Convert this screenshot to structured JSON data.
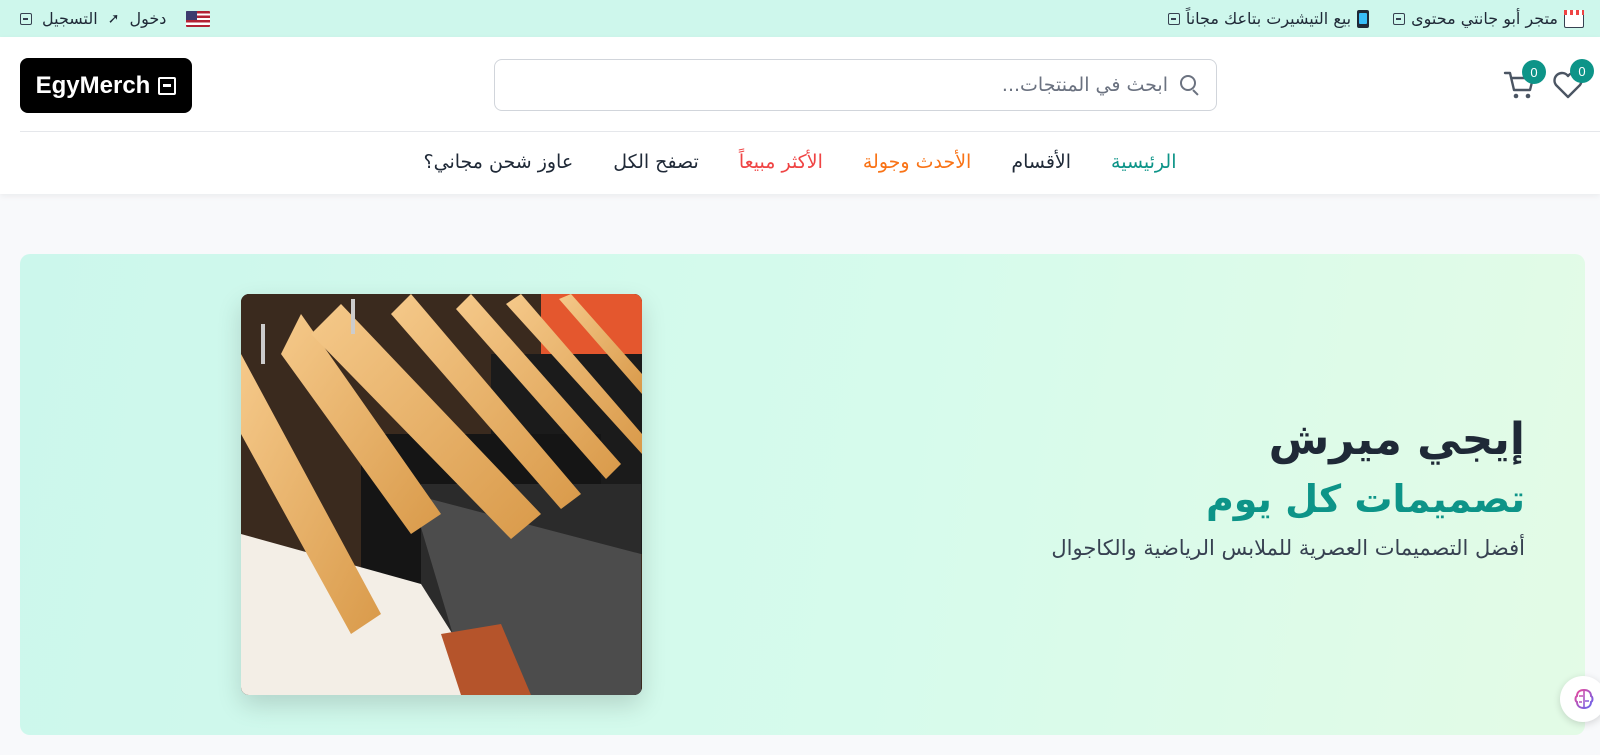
{
  "topbar": {
    "language_flag": "us-flag-icon",
    "login_label": "دخول",
    "register_label": "التسجيل",
    "promo_store": "متجر أبو جانتي محتوى",
    "promo_sell": "بيع التيشيرت بتاعك مجاناً"
  },
  "header": {
    "logo_text": "EgyMerch",
    "search_placeholder": "ابحث في المنتجات...",
    "cart_count": "0",
    "wishlist_count": "0"
  },
  "nav": {
    "items": [
      {
        "label": "الرئيسية"
      },
      {
        "label": "الأقسام"
      },
      {
        "label": "الأحدث وجولة"
      },
      {
        "label": "الأكثر مبيعاً"
      },
      {
        "label": "تصفح الكل"
      },
      {
        "label": "عاوز شحن مجاني؟"
      }
    ]
  },
  "hero": {
    "title": "إيجي ميرش",
    "subtitle": "تصميمات كل يوم",
    "description": "أفضل التصميمات العصرية للملابس الرياضية والكاجوال"
  },
  "colors": {
    "accent": "#0d9488",
    "newest": "#f97316",
    "best": "#ef4444",
    "topbar_bg": "#cef7ec"
  }
}
